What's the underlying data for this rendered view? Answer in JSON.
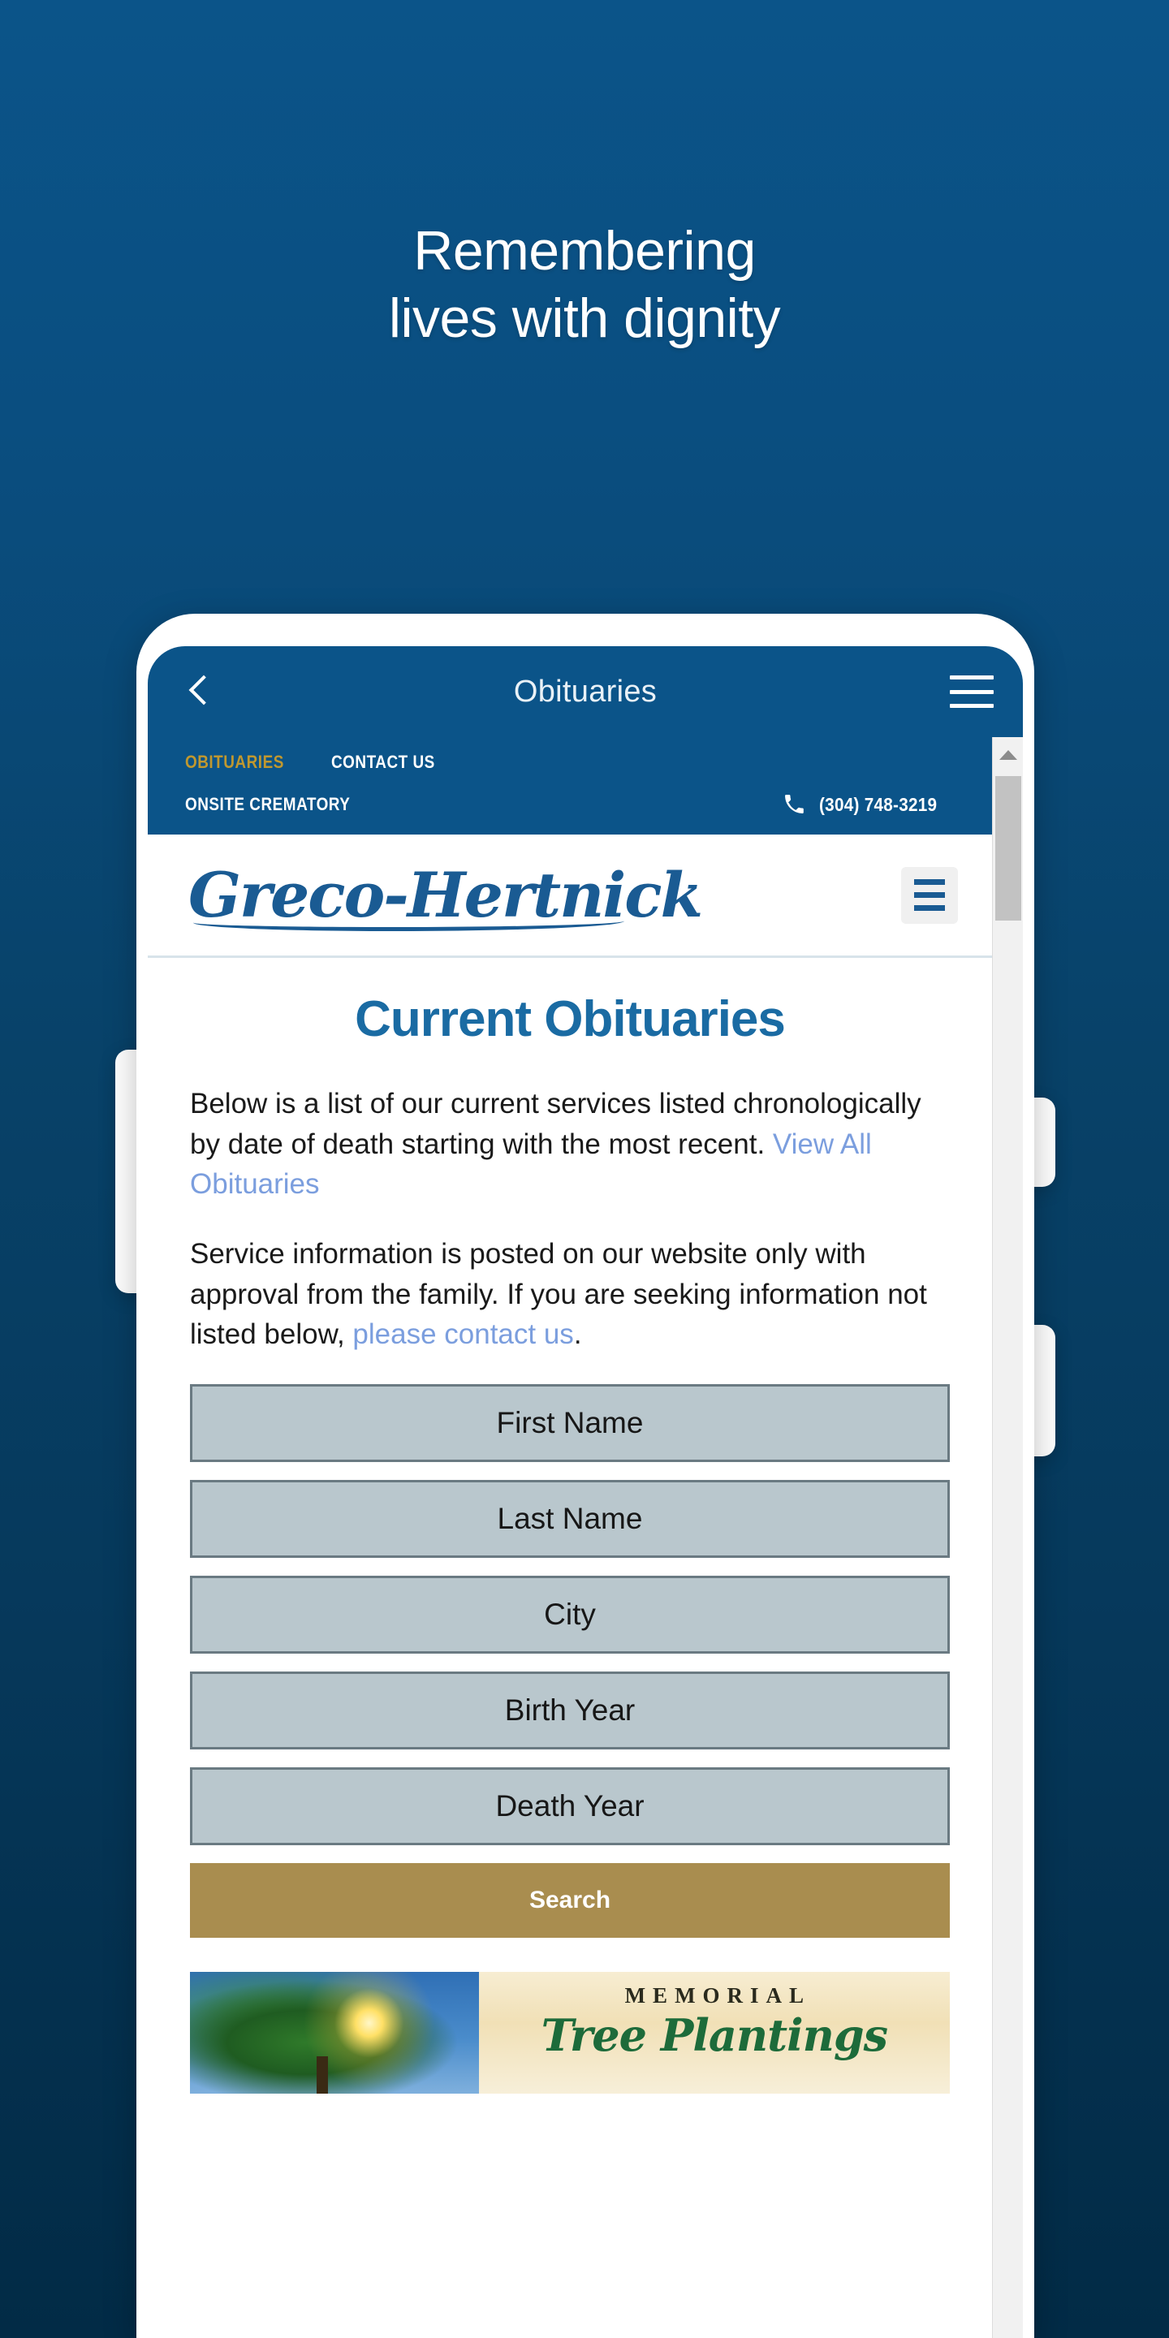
{
  "hero": {
    "headline_line1": "Remembering",
    "headline_line2": "lives with dignity"
  },
  "app_bar": {
    "title": "Obituaries",
    "back_icon": "chevron-left-icon",
    "menu_icon": "hamburger-icon"
  },
  "site": {
    "topbar": {
      "links": [
        {
          "label": "OBITUARIES",
          "color": "#c0982f"
        },
        {
          "label": "CONTACT US",
          "color": "#ffffff"
        }
      ],
      "secondary_label": "ONSITE CREMATORY",
      "phone_icon": "phone-icon",
      "phone_number": "(304) 748-3219"
    },
    "logo_text": "Greco-Hertnick",
    "menu_icon": "hamburger-icon"
  },
  "page": {
    "title": "Current Obituaries",
    "paragraph1_text": "Below is a list of our current services listed chronologically by date of death starting with the most recent. ",
    "paragraph1_link": "View All Obituaries",
    "paragraph2_text": "Service information is posted on our website only with approval from the family. If you are seeking information not listed below, ",
    "paragraph2_link": "please contact us",
    "paragraph2_tail": "."
  },
  "search_form": {
    "fields": [
      {
        "name": "first-name",
        "placeholder": "First Name",
        "value": ""
      },
      {
        "name": "last-name",
        "placeholder": "Last Name",
        "value": ""
      },
      {
        "name": "city",
        "placeholder": "City",
        "value": ""
      },
      {
        "name": "birth-year",
        "placeholder": "Birth Year",
        "value": ""
      },
      {
        "name": "death-year",
        "placeholder": "Death Year",
        "value": ""
      }
    ],
    "submit_label": "Search"
  },
  "memorial_banner": {
    "eyebrow": "MEMORIAL",
    "title": "Tree Plantings",
    "image_alt": "tree-with-sunburst-photo"
  },
  "scrollbar": {
    "up_arrow_icon": "triangle-up-icon"
  },
  "colors": {
    "background_top": "#0b5489",
    "background_bottom": "#022b46",
    "brand_blue": "#1a5b93",
    "accent_gold": "#a98d4f",
    "nav_gold": "#c0982f",
    "link_blue": "#7b9ede",
    "field_bg": "#b9c7cd"
  }
}
